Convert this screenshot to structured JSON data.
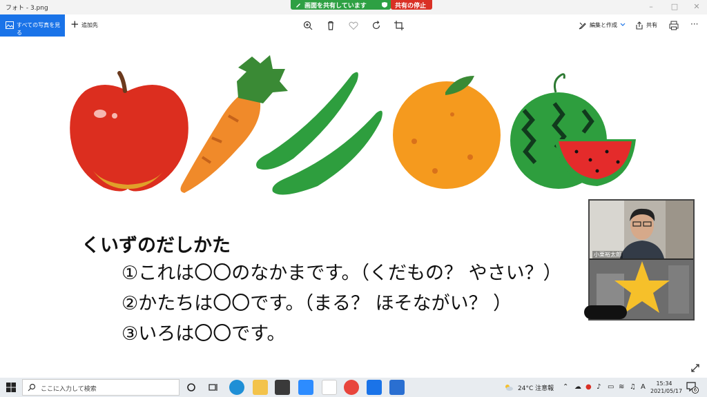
{
  "window": {
    "title": "フォト - 3.png",
    "share_banner": "画面を共有しています",
    "stop_share": "共有の停止"
  },
  "toolbar": {
    "see_all": "すべての写真を見る",
    "add_to": "追加先",
    "edit_create": "編集と作成",
    "share": "共有"
  },
  "quiz": {
    "heading": "くいずのだしかた",
    "lines": [
      "①これは〇〇のなかまです。（くだもの？ やさい？）",
      "②かたちは〇〇です。（まる？ ほそながい？ ）",
      "③いろは〇〇です。"
    ]
  },
  "video": {
    "participant_name": "小栗裕太郎"
  },
  "taskbar": {
    "search_placeholder": "ここに入力して検索",
    "weather": "24°C 注意報",
    "ime": "A",
    "time": "15:34",
    "date": "2021/05/17",
    "notification_count": "6"
  },
  "colors": {
    "accent": "#1a73e8",
    "share_green": "#2ea043",
    "stop_red": "#d93025"
  }
}
